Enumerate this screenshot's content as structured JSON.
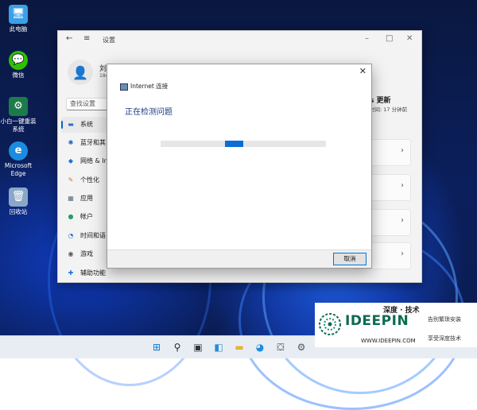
{
  "desktop": {
    "icons": [
      {
        "label": "此电脑",
        "glyph": "🖥"
      },
      {
        "label": "微信",
        "glyph": "💬"
      },
      {
        "label": "小白一键重装系统",
        "glyph": "⚙"
      },
      {
        "label": "Microsoft Edge",
        "glyph": "e"
      },
      {
        "label": "回收站",
        "glyph": "🗑"
      }
    ]
  },
  "settings": {
    "title": "设置",
    "user_name": "刘",
    "user_sub": "184",
    "search_placeholder": "查找设置",
    "nav": [
      {
        "label": "系统",
        "icon": "monitor-icon"
      },
      {
        "label": "蓝牙和其",
        "icon": "bluetooth-icon"
      },
      {
        "label": "网络 & In",
        "icon": "wifi-icon"
      },
      {
        "label": "个性化",
        "icon": "brush-icon"
      },
      {
        "label": "应用",
        "icon": "apps-icon"
      },
      {
        "label": "帐户",
        "icon": "person-icon"
      },
      {
        "label": "时间和语",
        "icon": "clock-icon"
      },
      {
        "label": "游戏",
        "icon": "gamepad-icon"
      },
      {
        "label": "辅助功能",
        "icon": "accessibility-icon"
      }
    ],
    "update_title": "s 更新",
    "update_sub": "时间: 17 分钟前"
  },
  "dialog": {
    "title": "Internet 连接",
    "heading": "正在检测问题",
    "cancel_label": "取消",
    "progress_fraction": 0.11,
    "progress_offset": 0.39
  },
  "watermark": {
    "cn": "深度 · 技术",
    "brand": "IDEEPIN",
    "url": "WWW.IDEEPIN.COM",
    "side1": "告别繁琐安装",
    "side2": "享受深度技术"
  },
  "colors": {
    "accent": "#0067c0",
    "progress": "#0b6cd6",
    "brand_green": "#0d6b52"
  }
}
